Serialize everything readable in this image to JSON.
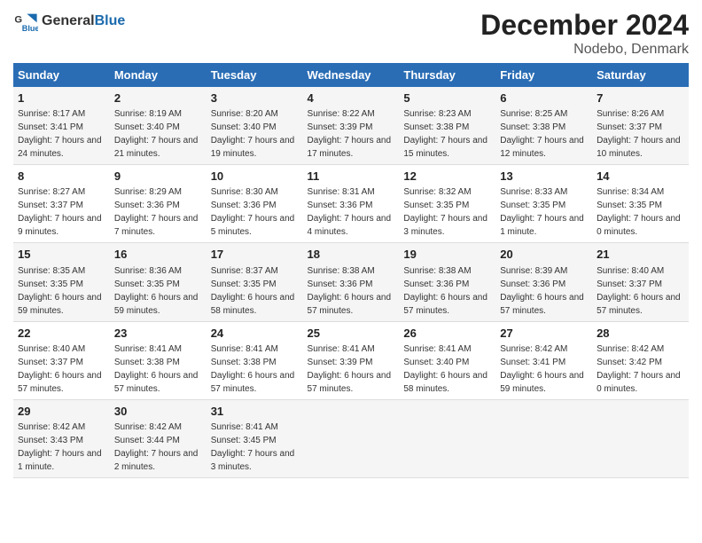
{
  "header": {
    "logo_general": "General",
    "logo_blue": "Blue",
    "title": "December 2024",
    "subtitle": "Nodebo, Denmark"
  },
  "columns": [
    "Sunday",
    "Monday",
    "Tuesday",
    "Wednesday",
    "Thursday",
    "Friday",
    "Saturday"
  ],
  "weeks": [
    [
      {
        "day": "1",
        "sunrise": "Sunrise: 8:17 AM",
        "sunset": "Sunset: 3:41 PM",
        "daylight": "Daylight: 7 hours and 24 minutes."
      },
      {
        "day": "2",
        "sunrise": "Sunrise: 8:19 AM",
        "sunset": "Sunset: 3:40 PM",
        "daylight": "Daylight: 7 hours and 21 minutes."
      },
      {
        "day": "3",
        "sunrise": "Sunrise: 8:20 AM",
        "sunset": "Sunset: 3:40 PM",
        "daylight": "Daylight: 7 hours and 19 minutes."
      },
      {
        "day": "4",
        "sunrise": "Sunrise: 8:22 AM",
        "sunset": "Sunset: 3:39 PM",
        "daylight": "Daylight: 7 hours and 17 minutes."
      },
      {
        "day": "5",
        "sunrise": "Sunrise: 8:23 AM",
        "sunset": "Sunset: 3:38 PM",
        "daylight": "Daylight: 7 hours and 15 minutes."
      },
      {
        "day": "6",
        "sunrise": "Sunrise: 8:25 AM",
        "sunset": "Sunset: 3:38 PM",
        "daylight": "Daylight: 7 hours and 12 minutes."
      },
      {
        "day": "7",
        "sunrise": "Sunrise: 8:26 AM",
        "sunset": "Sunset: 3:37 PM",
        "daylight": "Daylight: 7 hours and 10 minutes."
      }
    ],
    [
      {
        "day": "8",
        "sunrise": "Sunrise: 8:27 AM",
        "sunset": "Sunset: 3:37 PM",
        "daylight": "Daylight: 7 hours and 9 minutes."
      },
      {
        "day": "9",
        "sunrise": "Sunrise: 8:29 AM",
        "sunset": "Sunset: 3:36 PM",
        "daylight": "Daylight: 7 hours and 7 minutes."
      },
      {
        "day": "10",
        "sunrise": "Sunrise: 8:30 AM",
        "sunset": "Sunset: 3:36 PM",
        "daylight": "Daylight: 7 hours and 5 minutes."
      },
      {
        "day": "11",
        "sunrise": "Sunrise: 8:31 AM",
        "sunset": "Sunset: 3:36 PM",
        "daylight": "Daylight: 7 hours and 4 minutes."
      },
      {
        "day": "12",
        "sunrise": "Sunrise: 8:32 AM",
        "sunset": "Sunset: 3:35 PM",
        "daylight": "Daylight: 7 hours and 3 minutes."
      },
      {
        "day": "13",
        "sunrise": "Sunrise: 8:33 AM",
        "sunset": "Sunset: 3:35 PM",
        "daylight": "Daylight: 7 hours and 1 minute."
      },
      {
        "day": "14",
        "sunrise": "Sunrise: 8:34 AM",
        "sunset": "Sunset: 3:35 PM",
        "daylight": "Daylight: 7 hours and 0 minutes."
      }
    ],
    [
      {
        "day": "15",
        "sunrise": "Sunrise: 8:35 AM",
        "sunset": "Sunset: 3:35 PM",
        "daylight": "Daylight: 6 hours and 59 minutes."
      },
      {
        "day": "16",
        "sunrise": "Sunrise: 8:36 AM",
        "sunset": "Sunset: 3:35 PM",
        "daylight": "Daylight: 6 hours and 59 minutes."
      },
      {
        "day": "17",
        "sunrise": "Sunrise: 8:37 AM",
        "sunset": "Sunset: 3:35 PM",
        "daylight": "Daylight: 6 hours and 58 minutes."
      },
      {
        "day": "18",
        "sunrise": "Sunrise: 8:38 AM",
        "sunset": "Sunset: 3:36 PM",
        "daylight": "Daylight: 6 hours and 57 minutes."
      },
      {
        "day": "19",
        "sunrise": "Sunrise: 8:38 AM",
        "sunset": "Sunset: 3:36 PM",
        "daylight": "Daylight: 6 hours and 57 minutes."
      },
      {
        "day": "20",
        "sunrise": "Sunrise: 8:39 AM",
        "sunset": "Sunset: 3:36 PM",
        "daylight": "Daylight: 6 hours and 57 minutes."
      },
      {
        "day": "21",
        "sunrise": "Sunrise: 8:40 AM",
        "sunset": "Sunset: 3:37 PM",
        "daylight": "Daylight: 6 hours and 57 minutes."
      }
    ],
    [
      {
        "day": "22",
        "sunrise": "Sunrise: 8:40 AM",
        "sunset": "Sunset: 3:37 PM",
        "daylight": "Daylight: 6 hours and 57 minutes."
      },
      {
        "day": "23",
        "sunrise": "Sunrise: 8:41 AM",
        "sunset": "Sunset: 3:38 PM",
        "daylight": "Daylight: 6 hours and 57 minutes."
      },
      {
        "day": "24",
        "sunrise": "Sunrise: 8:41 AM",
        "sunset": "Sunset: 3:38 PM",
        "daylight": "Daylight: 6 hours and 57 minutes."
      },
      {
        "day": "25",
        "sunrise": "Sunrise: 8:41 AM",
        "sunset": "Sunset: 3:39 PM",
        "daylight": "Daylight: 6 hours and 57 minutes."
      },
      {
        "day": "26",
        "sunrise": "Sunrise: 8:41 AM",
        "sunset": "Sunset: 3:40 PM",
        "daylight": "Daylight: 6 hours and 58 minutes."
      },
      {
        "day": "27",
        "sunrise": "Sunrise: 8:42 AM",
        "sunset": "Sunset: 3:41 PM",
        "daylight": "Daylight: 6 hours and 59 minutes."
      },
      {
        "day": "28",
        "sunrise": "Sunrise: 8:42 AM",
        "sunset": "Sunset: 3:42 PM",
        "daylight": "Daylight: 7 hours and 0 minutes."
      }
    ],
    [
      {
        "day": "29",
        "sunrise": "Sunrise: 8:42 AM",
        "sunset": "Sunset: 3:43 PM",
        "daylight": "Daylight: 7 hours and 1 minute."
      },
      {
        "day": "30",
        "sunrise": "Sunrise: 8:42 AM",
        "sunset": "Sunset: 3:44 PM",
        "daylight": "Daylight: 7 hours and 2 minutes."
      },
      {
        "day": "31",
        "sunrise": "Sunrise: 8:41 AM",
        "sunset": "Sunset: 3:45 PM",
        "daylight": "Daylight: 7 hours and 3 minutes."
      },
      null,
      null,
      null,
      null
    ]
  ]
}
